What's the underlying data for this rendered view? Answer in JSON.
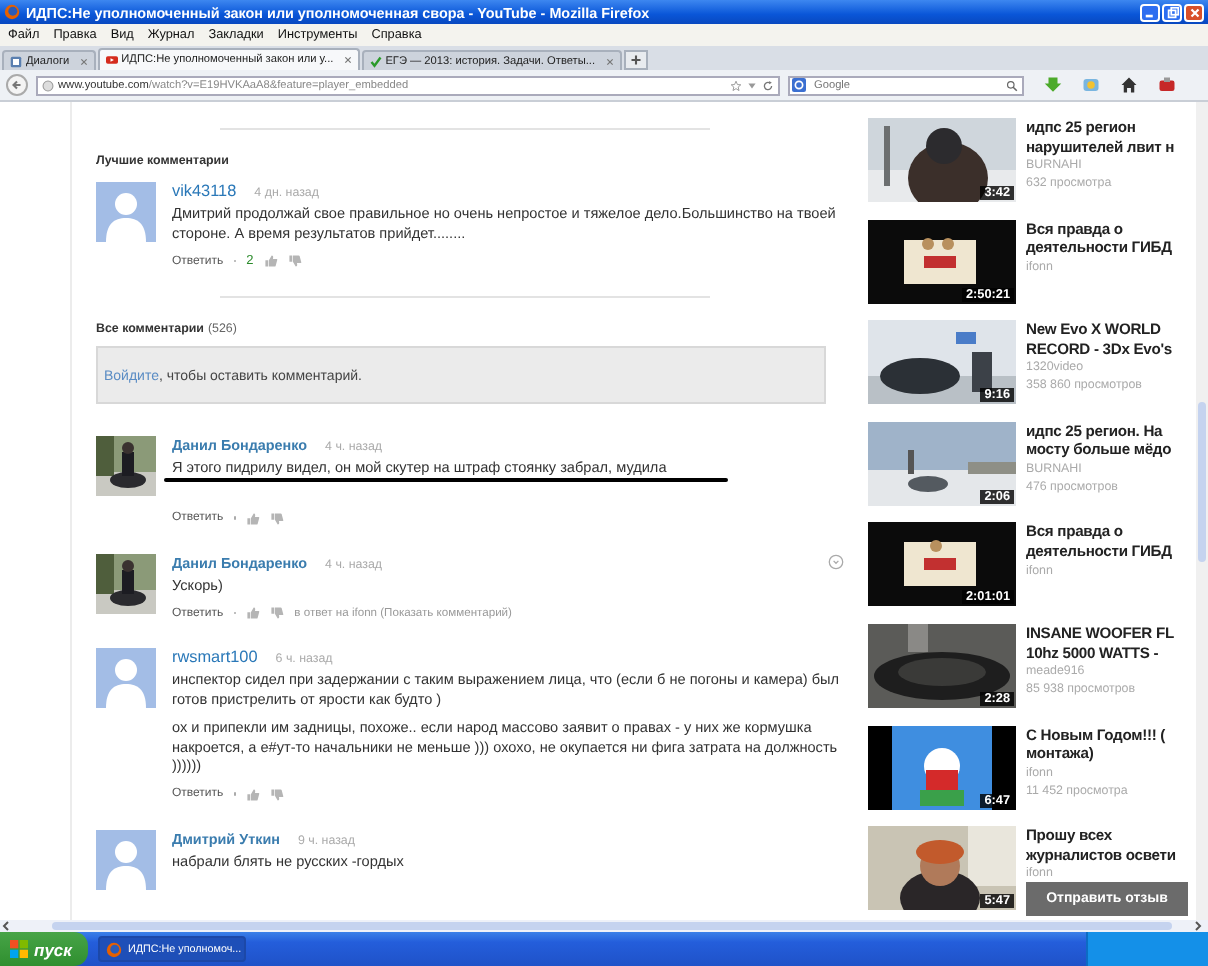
{
  "window": {
    "title": "ИДПС:Не уполномоченный закон или уполномоченная свора - YouTube - Mozilla Firefox"
  },
  "menu": [
    "Файл",
    "Правка",
    "Вид",
    "Журнал",
    "Закладки",
    "Инструменты",
    "Справка"
  ],
  "tabs": [
    {
      "label": "Диалоги",
      "selected": false
    },
    {
      "label": "ИДПС:Не уполномоченный закон или у...",
      "selected": true
    },
    {
      "label": "ЕГЭ — 2013: история. Задачи. Ответы...",
      "selected": false
    }
  ],
  "address_bar": {
    "host": "www.youtube.com",
    "path": "/watch?v=E19HVKAaA8&feature=player_embedded"
  },
  "search": {
    "placeholder": "Google"
  },
  "top_comments": {
    "heading": "Лучшие комментарии",
    "comments": [
      {
        "author": "vik43118",
        "time": "4 дн. назад",
        "has_photo": false,
        "bold_author": false,
        "paragraphs": [
          "Дмитрий продолжай свое правильное но очень непростое и тяжелое дело.Большинство на твоей стороне. А время результатов прийдет........"
        ],
        "underlined": false,
        "reply": "Ответить",
        "likes": "2",
        "options_button": false
      }
    ]
  },
  "all_comments": {
    "heading": "Все комментарии",
    "count": "(526)",
    "login_link": "Войдите",
    "login_text": ", чтобы оставить комментарий.",
    "comments": [
      {
        "author": "Данил Бондаренко",
        "time": "4 ч. назад",
        "has_photo": true,
        "bold_author": true,
        "paragraphs": [
          "Я этого пидрилу видел, он мой скутер на штраф стоянку забрал, мудила"
        ],
        "underlined": true,
        "reply": "Ответить",
        "options_button": false
      },
      {
        "author": "Данил Бондаренко",
        "time": "4 ч. назад",
        "has_photo": true,
        "bold_author": true,
        "paragraphs": [
          "Ускорь)"
        ],
        "underlined": false,
        "reply": "Ответить",
        "reply_note": "в ответ на ifonn (Показать комментарий)",
        "options_button": true
      },
      {
        "author": "rwsmart100",
        "time": "6 ч. назад",
        "has_photo": false,
        "bold_author": false,
        "paragraphs": [
          "инспектор сидел при задержании с таким выражением лица, что (если б не погоны и камера) был готов пристрелить от ярости как будто )",
          "ох и припекли им задницы, похоже.. если народ массово заявит о правах - у них же кормушка накроется, а е#ут-то начальники не меньше ))) охохо, не окупается ни фига затрата на должность ))))))"
        ],
        "underlined": false,
        "reply": "Ответить",
        "options_button": false
      },
      {
        "author": "Дмитрий Уткин",
        "time": "9 ч. назад",
        "has_photo": false,
        "bold_author": true,
        "paragraphs": [
          "набрали блять не русских -гордых"
        ],
        "underlined": false,
        "options_button": false
      }
    ]
  },
  "related_videos": [
    {
      "title": [
        "идпс 25 регион",
        "нарушителей лвит н"
      ],
      "channel": "BURNAHI",
      "views": "632 просмотра",
      "duration": "3:42"
    },
    {
      "title": [
        "Вся правда о",
        "деятельности ГИБД"
      ],
      "channel": "ifonn",
      "duration": "2:50:21"
    },
    {
      "title": [
        "New Evo X WORLD",
        "RECORD - 3Dx Evo's"
      ],
      "channel": "1320video",
      "views": "358 860 просмотров",
      "duration": "9:16"
    },
    {
      "title": [
        "идпс 25 регион. На",
        "мосту больше мёдо"
      ],
      "channel": "BURNAHI",
      "views": "476 просмотров",
      "duration": "2:06"
    },
    {
      "title": [
        "Вся правда о",
        "деятельности ГИБД"
      ],
      "channel": "ifonn",
      "duration": "2:01:01"
    },
    {
      "title": [
        "INSANE WOOFER FL",
        "10hz 5000 WATTS -"
      ],
      "channel": "meade916",
      "views": "85 938 просмотров",
      "duration": "2:28"
    },
    {
      "title": [
        "С Новым Годом!!! (",
        "монтажа)"
      ],
      "channel": "ifonn",
      "views": "11 452 просмотра",
      "duration": "6:47"
    },
    {
      "title": [
        "Прошу всех",
        "журналистов освети"
      ],
      "channel": "ifonn",
      "duration": "5:47"
    }
  ],
  "feedback_button": "Отправить отзыв",
  "taskbar": {
    "start": "пуск",
    "tasks": [
      {
        "label": "ИДПС:Не уполномоч...",
        "selected": true
      }
    ]
  }
}
